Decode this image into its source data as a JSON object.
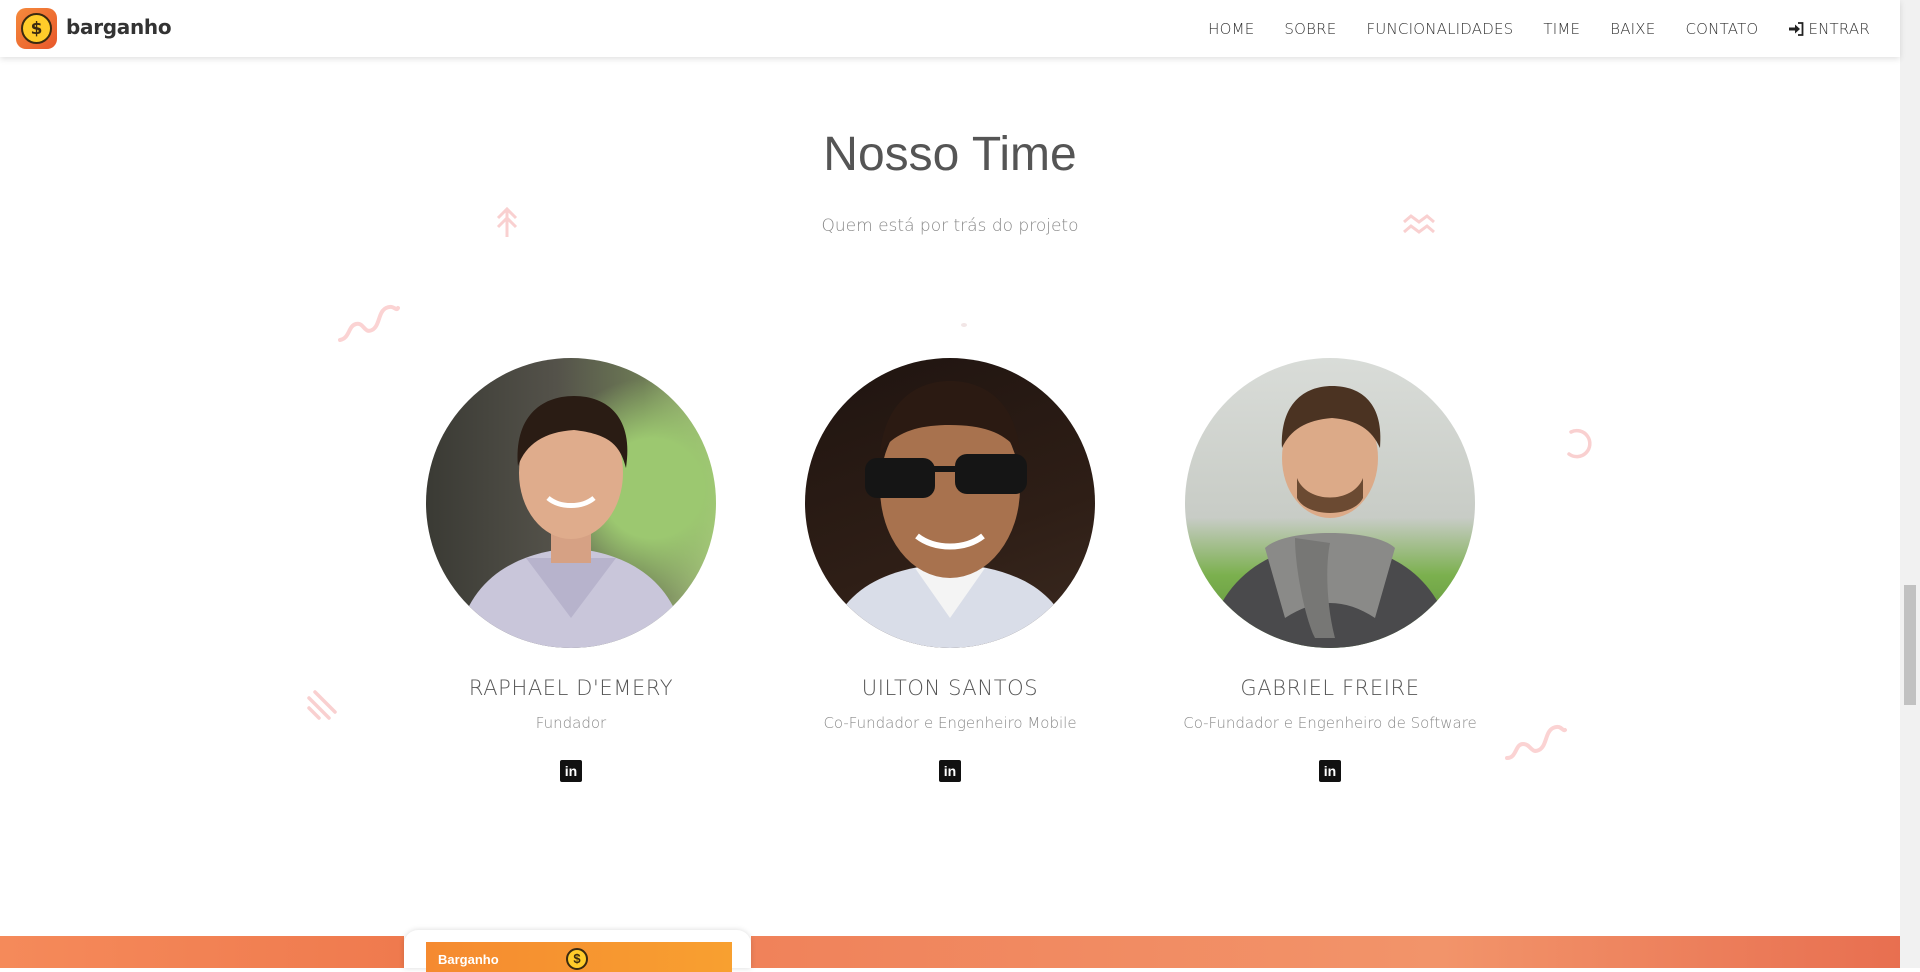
{
  "header": {
    "brand": "barganho",
    "nav": [
      "HOME",
      "SOBRE",
      "FUNCIONALIDADES",
      "TIME",
      "BAIXE",
      "CONTATO"
    ],
    "login_label": "ENTRAR"
  },
  "section": {
    "title": "Nosso Time",
    "subtitle": "Quem está por trás do projeto"
  },
  "members": [
    {
      "name": "RAPHAEL D'EMERY",
      "role": "Fundador"
    },
    {
      "name": "UILTON SANTOS",
      "role": "Co-Fundador e Engenheiro Mobile"
    },
    {
      "name": "GABRIEL FREIRE",
      "role": "Co-Fundador e Engenheiro de Software"
    }
  ],
  "linkedin_icon_text": "in",
  "footer_preview": {
    "app_title": "Barganho",
    "coin_symbol": "$"
  },
  "colors": {
    "accent": "#f58a3c",
    "deco": "#f9c7c7"
  }
}
